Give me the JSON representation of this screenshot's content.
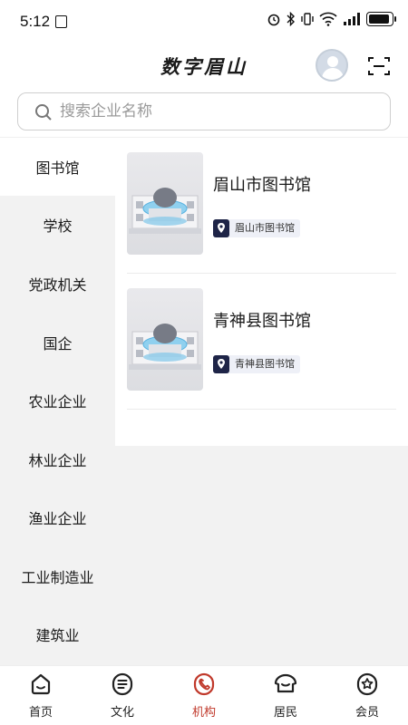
{
  "status_bar": {
    "time": "5:12"
  },
  "header": {
    "title": "数字眉山",
    "avatar_icon": "user-avatar-icon",
    "scan_icon": "scan-icon"
  },
  "search": {
    "placeholder": "搜索企业名称",
    "icon": "search-icon"
  },
  "sidebar": {
    "items": [
      {
        "label": "图书馆",
        "active": true
      },
      {
        "label": "学校"
      },
      {
        "label": "党政机关"
      },
      {
        "label": "国企"
      },
      {
        "label": "农业企业"
      },
      {
        "label": "林业企业"
      },
      {
        "label": "渔业企业"
      },
      {
        "label": "工业制造业"
      },
      {
        "label": "建筑业"
      }
    ]
  },
  "list": {
    "items": [
      {
        "name": "眉山市图书馆",
        "tag": "眉山市图书馆"
      },
      {
        "name": "青神县图书馆",
        "tag": "青神县图书馆"
      }
    ]
  },
  "bottom_nav": {
    "items": [
      {
        "label": "首页",
        "icon": "home-icon"
      },
      {
        "label": "文化",
        "icon": "culture-icon"
      },
      {
        "label": "机构",
        "icon": "institution-icon",
        "active": true
      },
      {
        "label": "居民",
        "icon": "resident-icon"
      },
      {
        "label": "会员",
        "icon": "member-icon"
      }
    ]
  },
  "colors": {
    "accent": "#c0392b",
    "tag_bg": "#eef0f7",
    "pin": "#1e2447"
  }
}
